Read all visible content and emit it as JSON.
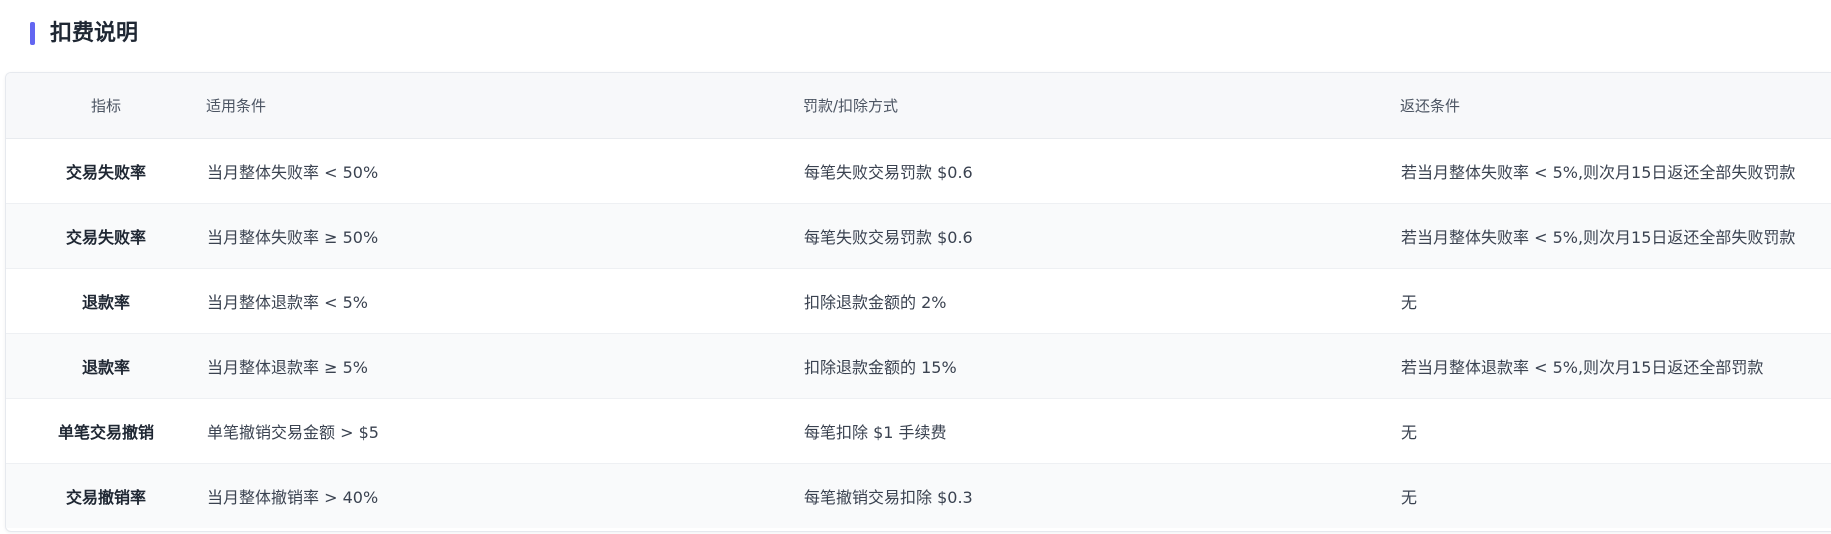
{
  "section": {
    "title": "扣费说明",
    "accent_color": "#6366f1"
  },
  "table": {
    "columns": [
      "指标",
      "适用条件",
      "罚款/扣除方式",
      "返还条件"
    ],
    "rows": [
      {
        "metric": "交易失败率",
        "condition": "当月整体失败率 < 50%",
        "penalty": "每笔失败交易罚款 $0.6",
        "refund": "若当月整体失败率 < 5%,则次月15日返还全部失败罚款"
      },
      {
        "metric": "交易失败率",
        "condition": "当月整体失败率 ≥ 50%",
        "penalty": "每笔失败交易罚款 $0.6",
        "refund": "若当月整体失败率 < 5%,则次月15日返还全部失败罚款"
      },
      {
        "metric": "退款率",
        "condition": "当月整体退款率 < 5%",
        "penalty": "扣除退款金额的 2%",
        "refund": "无"
      },
      {
        "metric": "退款率",
        "condition": "当月整体退款率 ≥ 5%",
        "penalty": "扣除退款金额的 15%",
        "refund": "若当月整体退款率 < 5%,则次月15日返还全部罚款"
      },
      {
        "metric": "单笔交易撤销",
        "condition": "单笔撤销交易金额 > $5",
        "penalty": "每笔扣除 $1 手续费",
        "refund": "无"
      },
      {
        "metric": "交易撤销率",
        "condition": "当月整体撤销率 > 40%",
        "penalty": "每笔撤销交易扣除 $0.3",
        "refund": "无"
      }
    ]
  }
}
